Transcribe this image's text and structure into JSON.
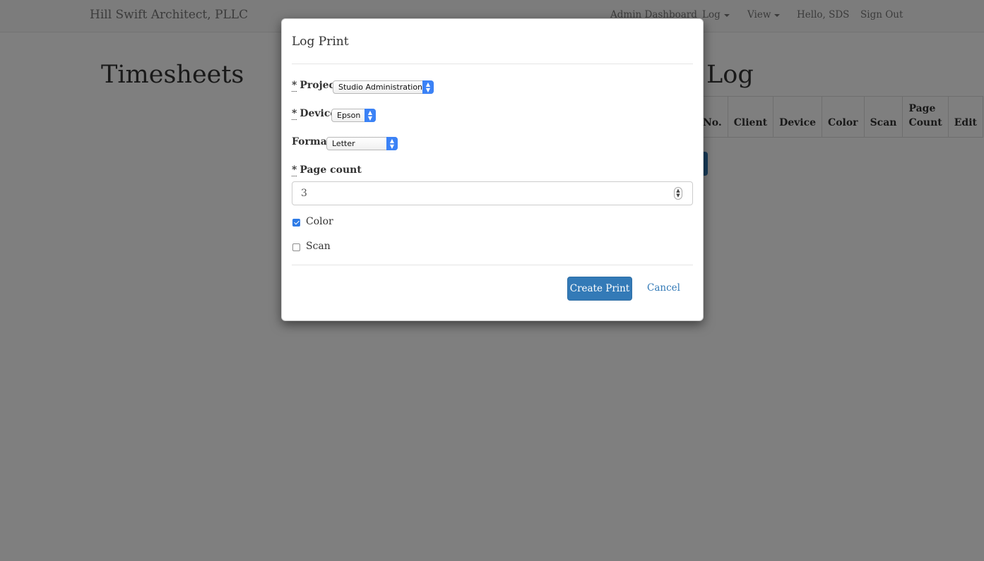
{
  "navbar": {
    "brand": "Hill Swift Architect, PLLC",
    "items": [
      {
        "label": "Admin Dashboard"
      },
      {
        "label": "Log"
      },
      {
        "label": "View"
      },
      {
        "label": "Hello, SDS"
      },
      {
        "label": "Sign Out"
      }
    ]
  },
  "page": {
    "left_heading": "Timesheets",
    "right_heading": "Log",
    "table_headers": [
      "No.",
      "Client",
      "Device",
      "Color",
      "Scan",
      "Page Count",
      "Edit"
    ]
  },
  "modal": {
    "title": "Log Print",
    "required_marker": "*",
    "project": {
      "label": "Project",
      "value": "Studio Administration"
    },
    "device": {
      "label": "Device",
      "value": "Epson"
    },
    "format": {
      "label": "Format",
      "value": "Letter"
    },
    "page_count": {
      "label": "Page count",
      "value": "3"
    },
    "color": {
      "label": "Color",
      "checked": true
    },
    "scan": {
      "label": "Scan",
      "checked": false
    },
    "submit_label": "Create Print",
    "cancel_label": "Cancel"
  },
  "colors": {
    "primary": "#337ab7",
    "checkbox_checked": "#2e7be6",
    "select_arrow": "#3b82f6"
  }
}
